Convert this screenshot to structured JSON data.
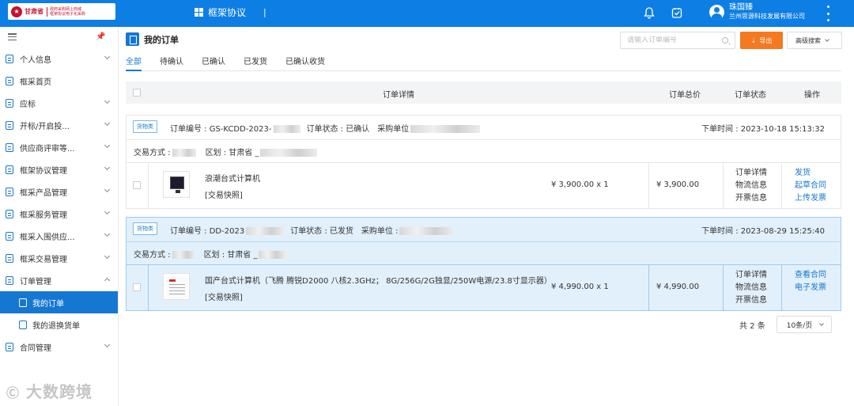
{
  "header": {
    "logo": {
      "name": "甘肃省",
      "line1": "政府采购网上商城",
      "line2": "框架协议电子化采购"
    },
    "app_title": "框架协议",
    "title_sep": "|",
    "user": {
      "name": "珠国臻",
      "org": "兰州思源科技发展有限公司"
    },
    "icons": [
      "bell-icon",
      "clipboard-check-icon",
      "user-avatar-icon",
      "more-vertical-icon"
    ]
  },
  "sidebar": {
    "items": [
      {
        "label": "个人信息",
        "chevron": "down"
      },
      {
        "label": "框采首页",
        "chevron": ""
      },
      {
        "label": "应标",
        "chevron": "down"
      },
      {
        "label": "开标/开启投...",
        "chevron": "down"
      },
      {
        "label": "供应商评审等...",
        "chevron": "down"
      },
      {
        "label": "框架协议管理",
        "chevron": "down"
      },
      {
        "label": "框采产品管理",
        "chevron": "down"
      },
      {
        "label": "框采服务管理",
        "chevron": "down"
      },
      {
        "label": "框采入围供应...",
        "chevron": "down"
      },
      {
        "label": "框采交易管理",
        "chevron": "down"
      },
      {
        "label": "订单管理",
        "chevron": "up"
      }
    ],
    "subitems": [
      {
        "label": "我的订单",
        "active": true
      },
      {
        "label": "我的退换货单",
        "active": false
      }
    ],
    "last_item": {
      "label": "合同管理",
      "chevron": "down"
    },
    "watermark": "大数跨境"
  },
  "main": {
    "page_title": "我的订单",
    "search_placeholder": "请输入订单编号",
    "export_label": "导出",
    "export_icon": "⇣",
    "advanced_search_label": "高级搜索",
    "tabs": [
      "全部",
      "待确认",
      "已确认",
      "已发货",
      "已确认收货"
    ],
    "active_tab": 0,
    "columns": {
      "detail": "订单详情",
      "total": "订单总价",
      "status": "订单状态",
      "ops": "操作"
    }
  },
  "orders": [
    {
      "tag": "货物类",
      "order_no": "订单编号 : GS-KCDD-2023-",
      "order_status": "订单状态 : 已确认",
      "purchaser_label": "采购单位",
      "order_time": "下单时间 : 2023-10-18 15:13:32",
      "trade_label": "交易方式 :",
      "region": "区划 : 甘肃省 _",
      "product_name": "浪潮台式计算机",
      "product_sub": "[交易快照]",
      "price_qty": "¥ 3,900.00 x 1",
      "total": "¥  3,900.00",
      "status_links": [
        "订单详情",
        "物流信息",
        "开票信息"
      ],
      "ops": [
        "发货",
        "起草合同",
        "上传发票"
      ]
    },
    {
      "tag": "货物类",
      "order_no": "订单编号 : DD-2023",
      "order_status": "订单状态 : 已发货",
      "purchaser_label": "采购单位 :",
      "order_time": "下单时间 : 2023-08-29 15:25:40",
      "trade_label": "交易方式 :",
      "region": "区划 : 甘肃省 _",
      "product_name": "国产台式计算机（飞腾 腾锐D2000 八核2.3GHz； 8G/256G/2G独显/250W电源/23.8寸显示器）",
      "product_sub": "[交易快照]",
      "price_qty": "¥ 4,990.00 x 1",
      "total": "¥  4,990.00",
      "status_links": [
        "订单详情",
        "物流信息",
        "开票信息"
      ],
      "ops": [
        "查看合同",
        "电子发票"
      ]
    }
  ],
  "pagination": {
    "total": "共 2 条",
    "page_size": "10条/页"
  },
  "colors": {
    "primary": "#1677d2",
    "header_bg": "#0d7ee3",
    "export": "#f47920",
    "highlight_row": "#e2f0fb"
  }
}
